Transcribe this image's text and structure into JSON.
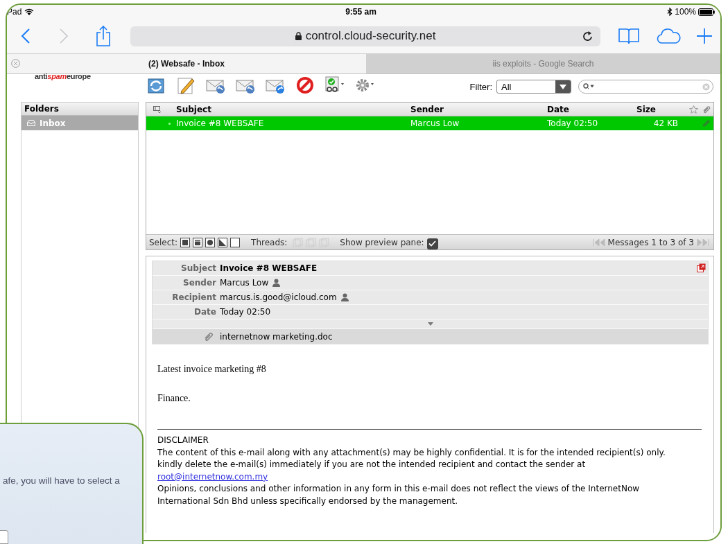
{
  "status_bar": {
    "device": "Pad",
    "time": "9:55 am",
    "battery": "100%"
  },
  "browser": {
    "url": "control.cloud-security.net",
    "tabs": [
      {
        "title": "(2) Websafe - Inbox",
        "selected": true
      },
      {
        "title": "iis exploits - Google Search",
        "selected": false
      }
    ]
  },
  "webmail": {
    "logo": [
      {
        "text": "anti",
        "kind": "plain"
      },
      {
        "text": "spam",
        "kind": "accent"
      },
      {
        "text": "europe",
        "kind": "plain"
      }
    ],
    "filter": {
      "label": "Filter:",
      "value": "All"
    },
    "folders": {
      "title": "Folders",
      "items": [
        {
          "name": "Inbox",
          "selected": true
        }
      ]
    },
    "message_list": {
      "columns": [
        "Subject",
        "Sender",
        "Date",
        "Size"
      ],
      "rows": [
        {
          "subject": "Invoice #8 WEBSAFE",
          "sender": "Marcus Low",
          "date": "Today 02:50",
          "size": "42 KB",
          "selected": true
        }
      ]
    },
    "list_footer": {
      "select_label": "Select:",
      "threads_label": "Threads:",
      "preview_label": "Show preview pane:",
      "preview_checked": true,
      "pager": "Messages 1 to 3 of 3"
    },
    "preview": {
      "fields": [
        {
          "label": "Subject",
          "value": "Invoice #8 WEBSAFE",
          "kind": "subject"
        },
        {
          "label": "Sender",
          "value": "Marcus Low",
          "kind": "contact"
        },
        {
          "label": "Recipient",
          "value": "marcus.is.good@icloud.com",
          "kind": "contact"
        },
        {
          "label": "Date",
          "value": "Today 02:50",
          "kind": "plain"
        }
      ],
      "attachment": "internetnow marketing.doc",
      "body": [
        "Latest invoice marketing #8",
        "Finance."
      ],
      "disclaimer": {
        "title": "DISCLAIMER",
        "text": "The content of this e-mail along with any attachment(s) may be highly confidential. It is for the intended recipient(s) only. kindly delete the e-mail(s) immediately if you are not the intended recipient and contact the sender at",
        "link": "root@internetnow.com.my",
        "note": "Opinions, conclusions and other information in any form in this e-mail does not reflect the views of the InternetNow International Sdn Bhd unless specifically endorsed by the management."
      }
    }
  },
  "overlay_card": {
    "text": "afe, you will have to select a"
  }
}
